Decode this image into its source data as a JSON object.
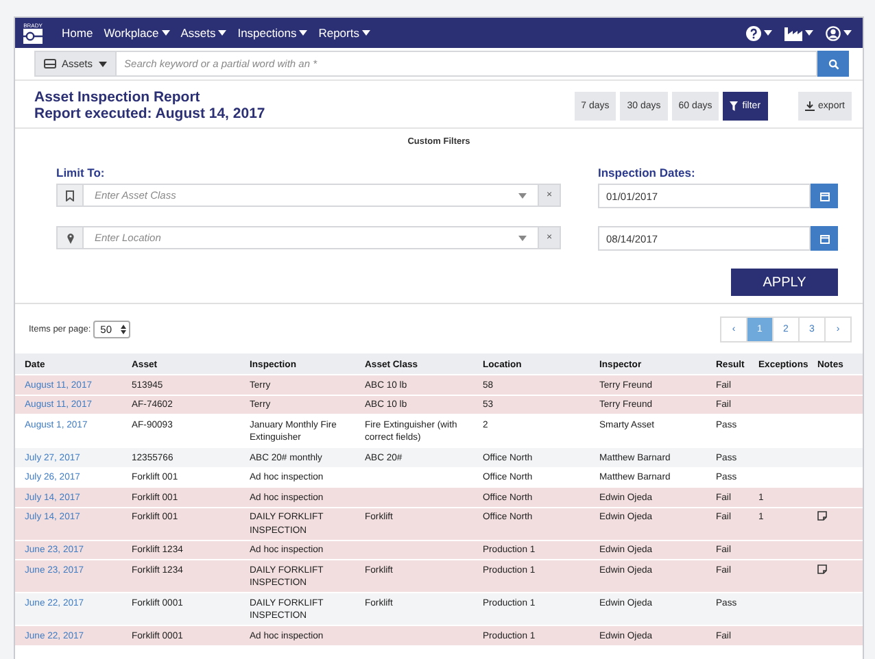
{
  "nav": {
    "logo": "BRADY",
    "items": [
      {
        "label": "Home",
        "caret": false
      },
      {
        "label": "Workplace",
        "caret": true
      },
      {
        "label": "Assets",
        "caret": true
      },
      {
        "label": "Inspections",
        "caret": true
      },
      {
        "label": "Reports",
        "caret": true
      }
    ],
    "icons": [
      {
        "kind": "help"
      },
      {
        "kind": "factory"
      },
      {
        "kind": "user"
      }
    ]
  },
  "search": {
    "scope": "Assets",
    "placeholder": "Search keyword or a partial word with an *"
  },
  "report": {
    "title": "Asset Inspection Report",
    "subtitle": "Report executed: August 14, 2017"
  },
  "ranges": [
    {
      "label": "7 days",
      "selected": false
    },
    {
      "label": "30 days",
      "selected": false
    },
    {
      "label": "60 days",
      "selected": false
    },
    {
      "label": "filter",
      "selected": true
    }
  ],
  "export": "export",
  "filters": {
    "heading": "Custom Filters",
    "limit_label": "Limit To:",
    "asset_class_placeholder": "Enter Asset Class",
    "location_placeholder": "Enter Location",
    "clear": "×",
    "dates_label": "Inspection Dates:",
    "start": "01/01/2017",
    "end": "08/14/2017",
    "apply": "APPLY"
  },
  "paging": {
    "items_label": "Items per page:",
    "per_page": "50",
    "prev": "‹",
    "next": "›",
    "pages": [
      {
        "label": "1",
        "selected": true
      },
      {
        "label": "2",
        "selected": false
      },
      {
        "label": "3",
        "selected": false
      }
    ]
  },
  "table": {
    "columns": [
      "Date",
      "Asset",
      "Inspection",
      "Asset Class",
      "Location",
      "Inspector",
      "Result",
      "Exceptions",
      "Notes"
    ],
    "rows": [
      {
        "kind": "failed",
        "date": "August 11, 2017",
        "asset": "513945",
        "inspection": "Terry",
        "asset_class": "ABC 10 lb",
        "location": "58",
        "inspector": "Terry Freund",
        "result": "Fail",
        "exceptions": "",
        "note": false
      },
      {
        "kind": "failed",
        "date": "August 11, 2017",
        "asset": "AF-74602",
        "inspection": "Terry",
        "asset_class": "ABC 10 lb",
        "location": "53",
        "inspector": "Terry Freund",
        "result": "Fail",
        "exceptions": "",
        "note": false
      },
      {
        "kind": "plain",
        "date": "August 1, 2017",
        "asset": "AF-90093",
        "inspection": "January Monthly Fire Extinguisher",
        "asset_class": "Fire Extinguisher (with correct fields)",
        "location": "2",
        "inspector": "Smarty Asset",
        "result": "Pass",
        "exceptions": "",
        "note": false
      },
      {
        "kind": "striped",
        "date": "July 27, 2017",
        "asset": "12355766",
        "inspection": "ABC 20# monthly",
        "asset_class": "ABC 20#",
        "location": "Office North",
        "inspector": "Matthew Barnard",
        "result": "Pass",
        "exceptions": "",
        "note": false
      },
      {
        "kind": "plain",
        "date": "July 26, 2017",
        "asset": "Forklift 001",
        "inspection": "Ad hoc inspection",
        "asset_class": "",
        "location": "Office North",
        "inspector": "Matthew Barnard",
        "result": "Pass",
        "exceptions": "",
        "note": false
      },
      {
        "kind": "failed",
        "date": "July 14, 2017",
        "asset": "Forklift 001",
        "inspection": "Ad hoc inspection",
        "asset_class": "",
        "location": "Office North",
        "inspector": "Edwin Ojeda",
        "result": "Fail",
        "exceptions": "1",
        "note": false
      },
      {
        "kind": "failed",
        "date": "July 14, 2017",
        "asset": "Forklift 001",
        "inspection": "DAILY FORKLIFT INSPECTION",
        "asset_class": "Forklift",
        "location": "Office North",
        "inspector": "Edwin Ojeda",
        "result": "Fail",
        "exceptions": "1",
        "note": true
      },
      {
        "kind": "failed",
        "date": "June 23, 2017",
        "asset": "Forklift 1234",
        "inspection": "Ad hoc inspection",
        "asset_class": "",
        "location": "Production 1",
        "inspector": "Edwin Ojeda",
        "result": "Fail",
        "exceptions": "",
        "note": false
      },
      {
        "kind": "failed",
        "date": "June 23, 2017",
        "asset": "Forklift 1234",
        "inspection": "DAILY FORKLIFT INSPECTION",
        "asset_class": "Forklift",
        "location": "Production 1",
        "inspector": "Edwin Ojeda",
        "result": "Fail",
        "exceptions": "",
        "note": true
      },
      {
        "kind": "striped",
        "date": "June 22, 2017",
        "asset": "Forklift 0001",
        "inspection": "DAILY FORKLIFT INSPECTION",
        "asset_class": "Forklift",
        "location": "Production 1",
        "inspector": "Edwin Ojeda",
        "result": "Pass",
        "exceptions": "",
        "note": false
      },
      {
        "kind": "failed",
        "date": "June 22, 2017",
        "asset": "Forklift 0001",
        "inspection": "Ad hoc inspection",
        "asset_class": "",
        "location": "Production 1",
        "inspector": "Edwin Ojeda",
        "result": "Fail",
        "exceptions": "",
        "note": false
      }
    ]
  }
}
